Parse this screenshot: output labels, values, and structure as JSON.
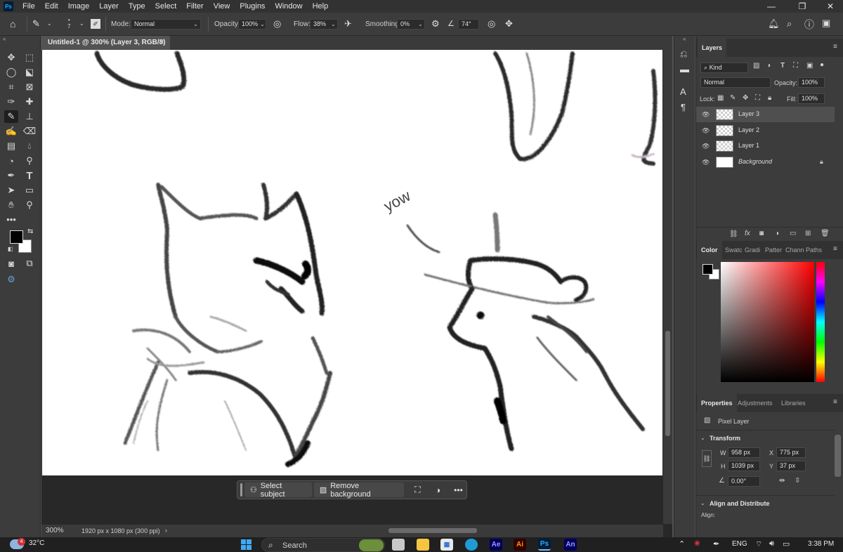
{
  "app": {
    "logo": "Ps"
  },
  "menu": [
    "File",
    "Edit",
    "Image",
    "Layer",
    "Type",
    "Select",
    "Filter",
    "View",
    "Plugins",
    "Window",
    "Help"
  ],
  "options": {
    "brush_size": "7",
    "mode_label": "Mode:",
    "mode_value": "Normal",
    "opacity_label": "Opacity:",
    "opacity_value": "100%",
    "flow_label": "Flow:",
    "flow_value": "38%",
    "smoothing_label": "Smoothing:",
    "smoothing_value": "0%",
    "angle_value": "74°"
  },
  "document": {
    "tab_title": "Untitled-1 @ 300% (Layer 3, RGB/8) *",
    "zoom": "300%",
    "doc_info": "1920 px x 1080 px (300 ppi)",
    "canvas_text": "yow"
  },
  "context_bar": {
    "select_subject": "Select subject",
    "remove_background": "Remove background"
  },
  "layers_panel": {
    "title": "Layers",
    "filter_kind": "Kind",
    "blend_mode": "Normal",
    "opacity_label": "Opacity:",
    "opacity_value": "100%",
    "lock_label": "Lock:",
    "fill_label": "Fill:",
    "fill_value": "100%",
    "layers": [
      {
        "name": "Layer 3",
        "selected": true
      },
      {
        "name": "Layer 2",
        "selected": false
      },
      {
        "name": "Layer 1",
        "selected": false
      },
      {
        "name": "Background",
        "selected": false,
        "locked": true
      }
    ]
  },
  "color_panel": {
    "tabs": [
      "Color",
      "Swatc",
      "Gradi",
      "Patter",
      "Chann",
      "Paths"
    ],
    "foreground": "#000000",
    "background": "#ffffff"
  },
  "properties_panel": {
    "tabs": [
      "Properties",
      "Adjustments",
      "Libraries"
    ],
    "kind": "Pixel Layer",
    "transform_title": "Transform",
    "w_label": "W",
    "w_value": "958 px",
    "x_label": "X",
    "x_value": "775 px",
    "h_label": "H",
    "h_value": "1039 px",
    "y_label": "Y",
    "y_value": "37 px",
    "angle_value": "0.00°",
    "align_title": "Align and Distribute",
    "align_label": "Align:"
  },
  "taskbar": {
    "weather_badge": "4",
    "temperature": "32°C",
    "search_placeholder": "Search",
    "apps": [
      "Ae",
      "Ai",
      "Ps",
      "An"
    ],
    "language": "ENG",
    "time": "3:38 PM"
  }
}
